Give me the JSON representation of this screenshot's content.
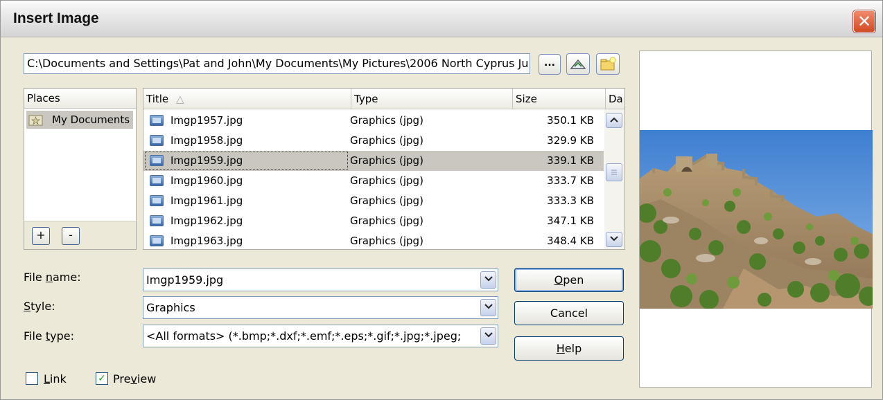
{
  "window": {
    "title": "Insert Image",
    "close_symbol": "✕"
  },
  "path_field": {
    "value": "C:\\Documents and Settings\\Pat and John\\My Documents\\My Pictures\\2006 North Cyprus Ju"
  },
  "toolbar": {
    "browse_label": "..."
  },
  "places": {
    "header": "Places",
    "items": [
      {
        "label": "My Documents"
      }
    ],
    "add_label": "+",
    "remove_label": "-"
  },
  "file_list": {
    "columns": {
      "title": "Title",
      "type": "Type",
      "size": "Size",
      "date": "Da"
    },
    "sort_indicator": "△",
    "rows": [
      {
        "name": "Imgp1957.jpg",
        "type": "Graphics (jpg)",
        "size": "350.1 KB",
        "selected": false
      },
      {
        "name": "Imgp1958.jpg",
        "type": "Graphics (jpg)",
        "size": "329.9 KB",
        "selected": false
      },
      {
        "name": "Imgp1959.jpg",
        "type": "Graphics (jpg)",
        "size": "339.1 KB",
        "selected": true
      },
      {
        "name": "Imgp1960.jpg",
        "type": "Graphics (jpg)",
        "size": "333.7 KB",
        "selected": false
      },
      {
        "name": "Imgp1961.jpg",
        "type": "Graphics (jpg)",
        "size": "333.3 KB",
        "selected": false
      },
      {
        "name": "Imgp1962.jpg",
        "type": "Graphics (jpg)",
        "size": "347.1 KB",
        "selected": false
      },
      {
        "name": "Imgp1963.jpg",
        "type": "Graphics (jpg)",
        "size": "348.4 KB",
        "selected": false
      }
    ]
  },
  "form": {
    "file_name_label_pre": "File ",
    "file_name_label_u": "n",
    "file_name_label_post": "ame:",
    "file_name_value": "Imgp1959.jpg",
    "style_label_u": "S",
    "style_label_post": "tyle:",
    "style_value": "Graphics",
    "file_type_label_pre": "File ",
    "file_type_label_u": "t",
    "file_type_label_post": "ype:",
    "file_type_value": "<All formats> (*.bmp;*.dxf;*.emf;*.eps;*.gif;*.jpg;*.jpeg;"
  },
  "buttons": {
    "open_u": "O",
    "open_post": "pen",
    "cancel": "Cancel",
    "help_u": "H",
    "help_post": "elp"
  },
  "options": {
    "link_u": "L",
    "link_post": "ink",
    "link_checked": false,
    "preview_pre": "Pre",
    "preview_u": "v",
    "preview_post": "iew",
    "preview_checked": true,
    "check_mark": "✓"
  },
  "preview_image": {
    "description_icon": "castle-photo",
    "sky_color": "#4a86d0"
  }
}
